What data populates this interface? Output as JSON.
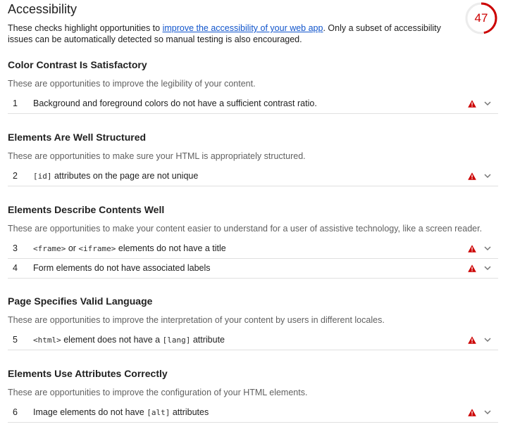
{
  "header": {
    "title": "Accessibility",
    "desc_before": "These checks highlight opportunities to ",
    "desc_link": "improve the accessibility of your web app",
    "desc_after": ". Only a subset of accessibility issues can be automatically detected so manual testing is also encouraged.",
    "score": "47",
    "score_fraction": 0.47,
    "score_color": "#cc0000"
  },
  "groups": [
    {
      "title": "Color Contrast Is Satisfactory",
      "desc": "These are opportunities to improve the legibility of your content.",
      "items": [
        {
          "index": "1",
          "parts": [
            {
              "t": "Background and foreground colors do not have a sufficient contrast ratio."
            }
          ]
        }
      ]
    },
    {
      "title": "Elements Are Well Structured",
      "desc": "These are opportunities to make sure your HTML is appropriately structured.",
      "items": [
        {
          "index": "2",
          "parts": [
            {
              "t": "[id]",
              "code": true
            },
            {
              "t": " attributes on the page are not unique"
            }
          ]
        }
      ]
    },
    {
      "title": "Elements Describe Contents Well",
      "desc": "These are opportunities to make your content easier to understand for a user of assistive technology, like a screen reader.",
      "items": [
        {
          "index": "3",
          "parts": [
            {
              "t": "<frame>",
              "code": true
            },
            {
              "t": " or "
            },
            {
              "t": "<iframe>",
              "code": true
            },
            {
              "t": " elements do not have a title"
            }
          ]
        },
        {
          "index": "4",
          "parts": [
            {
              "t": "Form elements do not have associated labels"
            }
          ]
        }
      ]
    },
    {
      "title": "Page Specifies Valid Language",
      "desc": "These are opportunities to improve the interpretation of your content by users in different locales.",
      "items": [
        {
          "index": "5",
          "parts": [
            {
              "t": "<html>",
              "code": true
            },
            {
              "t": " element does not have a "
            },
            {
              "t": "[lang]",
              "code": true
            },
            {
              "t": " attribute"
            }
          ]
        }
      ]
    },
    {
      "title": "Elements Use Attributes Correctly",
      "desc": "These are opportunities to improve the configuration of your HTML elements.",
      "items": [
        {
          "index": "6",
          "parts": [
            {
              "t": "Image elements do not have "
            },
            {
              "t": "[alt]",
              "code": true
            },
            {
              "t": " attributes"
            }
          ]
        }
      ]
    }
  ],
  "icons": {
    "warning": "warning-icon",
    "expand": "chevron-down-icon"
  },
  "colors": {
    "fail": "#cc0000",
    "link": "#1155cc",
    "chevron": "#757575"
  }
}
